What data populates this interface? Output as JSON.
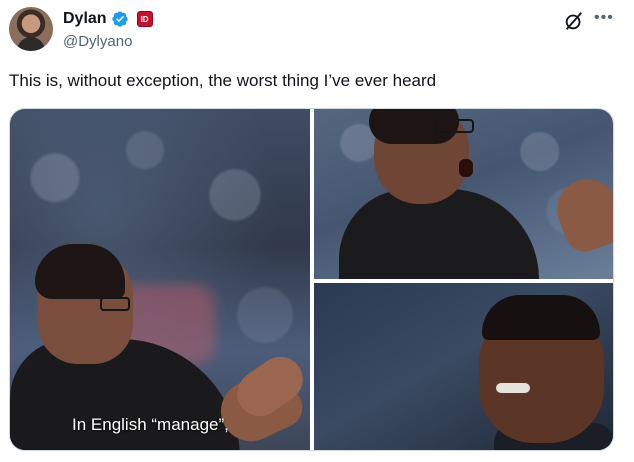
{
  "user": {
    "display_name": "Dylan",
    "handle": "@Dylyano",
    "verified": true,
    "badge_text": "ID"
  },
  "tweet": {
    "text": "This is, without exception, the worst thing I’ve ever heard"
  },
  "media": {
    "caption": "In English “manage”,"
  },
  "icons": {
    "grok": "grok-icon",
    "more": "more-icon",
    "verified": "verified-badge-icon"
  },
  "colors": {
    "text_primary": "#0f1419",
    "text_secondary": "#536471",
    "verified_blue": "#1d9bf0",
    "badge_red": "#c8102e"
  }
}
